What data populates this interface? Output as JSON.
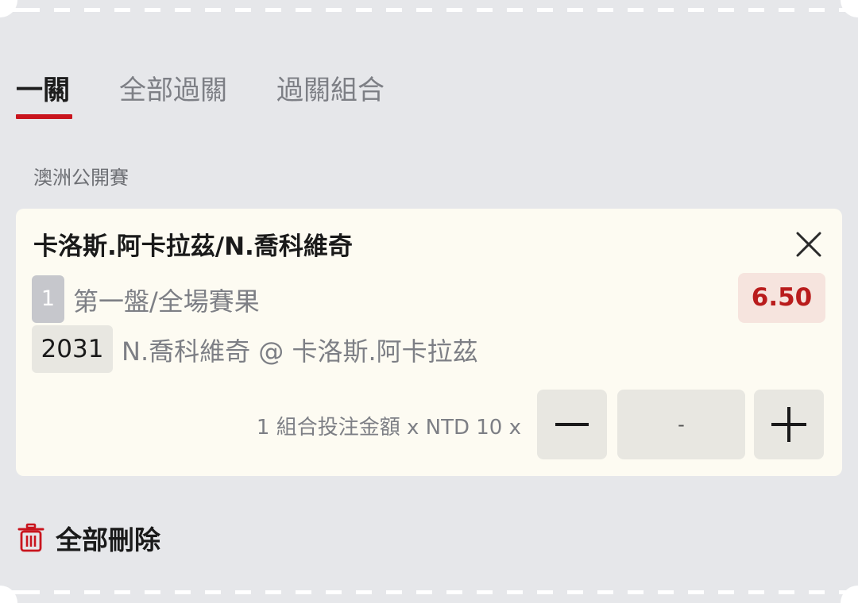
{
  "tabs": [
    {
      "label": "一關",
      "active": true
    },
    {
      "label": "全部過關",
      "active": false
    },
    {
      "label": "過關組合",
      "active": false
    }
  ],
  "league": "澳洲公開賽",
  "bet": {
    "match": "卡洛斯.阿卡拉茲/N.喬科維奇",
    "leg_number": "1",
    "market": "第一盤/全場賽果",
    "odds": "6.50",
    "code": "2031",
    "selection": "N.喬科維奇 @ 卡洛斯.阿卡拉茲",
    "stake_text": "1 組合投注金額 x NTD 10 x",
    "stake_value": "-"
  },
  "actions": {
    "delete_all": "全部刪除"
  },
  "icons": {
    "close": "close-icon",
    "minus": "minus-icon",
    "plus": "plus-icon",
    "trash": "trash-icon"
  },
  "colors": {
    "accent": "#c9151e",
    "odds_text": "#b91c1c",
    "odds_bg": "#f6e4de",
    "card_bg": "#fdfbf2",
    "page_bg": "#e6e7ea"
  }
}
